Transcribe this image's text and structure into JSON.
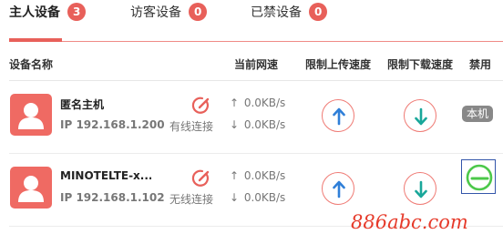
{
  "tabs": [
    {
      "label": "主人设备",
      "count": "3",
      "active": true
    },
    {
      "label": "访客设备",
      "count": "0",
      "active": false
    },
    {
      "label": "已禁设备",
      "count": "0",
      "active": false
    }
  ],
  "table": {
    "headers": {
      "device_name": "设备名称",
      "current_speed": "当前网速",
      "limit_upload": "限制上传速度",
      "limit_download": "限制下载速度",
      "disable": "禁用"
    }
  },
  "devices": [
    {
      "name": "匿名主机",
      "ip": "IP 192.168.1.200",
      "connection": "有线连接",
      "upload": "0.0KB/s",
      "download": "0.0KB/s",
      "badge": "本机"
    },
    {
      "name": "MINOTELTE-x...",
      "ip": "IP 192.168.1.102",
      "connection": "无线连接",
      "upload": "0.0KB/s",
      "download": "0.0KB/s"
    }
  ],
  "icons": {
    "arrow_up": "↑",
    "arrow_down": "↓"
  },
  "colors": {
    "accent": "#e8605a",
    "upload_arrow": "#2f7fd8",
    "download_arrow": "#19a79a",
    "toggle_green": "#4cc84a"
  },
  "watermark": "886abc.com"
}
